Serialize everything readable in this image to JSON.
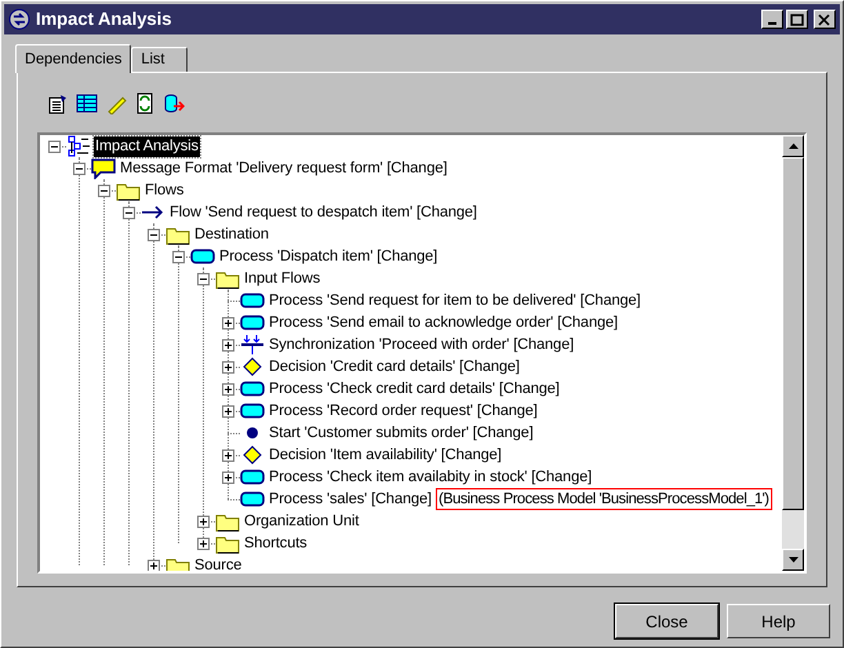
{
  "window": {
    "title": "Impact Analysis"
  },
  "tabs": [
    {
      "label": "Dependencies",
      "selected": true
    },
    {
      "label": "List",
      "selected": false
    }
  ],
  "tree": [
    {
      "kind": "root",
      "label": "Impact Analysis",
      "selected": true,
      "expanded": true,
      "children": [
        {
          "kind": "message",
          "label": "Message Format 'Delivery request form' [Change]",
          "selected": false,
          "expanded": true,
          "children": [
            {
              "kind": "folder",
              "label": "Flows",
              "selected": false,
              "expanded": true,
              "children": [
                {
                  "kind": "flow",
                  "label": "Flow 'Send request to despatch item' [Change]",
                  "selected": false,
                  "expanded": true,
                  "children": [
                    {
                      "kind": "folder",
                      "label": "Destination",
                      "selected": false,
                      "expanded": true,
                      "children": [
                        {
                          "kind": "process",
                          "label": "Process 'Dispatch item' [Change]",
                          "selected": false,
                          "expanded": true,
                          "children": [
                            {
                              "kind": "folder",
                              "label": "Input Flows",
                              "selected": false,
                              "expanded": true,
                              "children": [
                                {
                                  "kind": "process",
                                  "label": "Process 'Send request for item to be delivered' [Change]",
                                  "selected": false
                                },
                                {
                                  "kind": "process",
                                  "label": "Process 'Send email to acknowledge order' [Change]",
                                  "selected": false,
                                  "expanded": false
                                },
                                {
                                  "kind": "sync",
                                  "label": "Synchronization 'Proceed with order' [Change]",
                                  "selected": false,
                                  "expanded": false
                                },
                                {
                                  "kind": "decision",
                                  "label": "Decision 'Credit card details' [Change]",
                                  "selected": false,
                                  "expanded": false
                                },
                                {
                                  "kind": "process",
                                  "label": "Process 'Check credit card details' [Change]",
                                  "selected": false,
                                  "expanded": false
                                },
                                {
                                  "kind": "process",
                                  "label": "Process 'Record order request' [Change]",
                                  "selected": false,
                                  "expanded": false
                                },
                                {
                                  "kind": "start",
                                  "label": "Start 'Customer submits order' [Change]",
                                  "selected": false
                                },
                                {
                                  "kind": "decision",
                                  "label": "Decision 'Item availability' [Change]",
                                  "selected": false,
                                  "expanded": false
                                },
                                {
                                  "kind": "process",
                                  "label": "Process 'Check item availabity in stock' [Change]",
                                  "selected": false,
                                  "expanded": false
                                },
                                {
                                  "kind": "process",
                                  "label": "Process 'sales' [Change]",
                                  "note": "(Business Process Model 'BusinessProcessModel_1')",
                                  "selected": false
                                }
                              ]
                            },
                            {
                              "kind": "folder",
                              "label": "Organization Unit",
                              "selected": false,
                              "expanded": false
                            },
                            {
                              "kind": "folder",
                              "label": "Shortcuts",
                              "selected": false,
                              "expanded": false
                            }
                          ]
                        }
                      ]
                    },
                    {
                      "kind": "folder",
                      "label": "Source",
                      "selected": false,
                      "expanded": false
                    }
                  ]
                }
              ]
            }
          ]
        }
      ]
    }
  ],
  "buttons": [
    "Close",
    "Help"
  ]
}
